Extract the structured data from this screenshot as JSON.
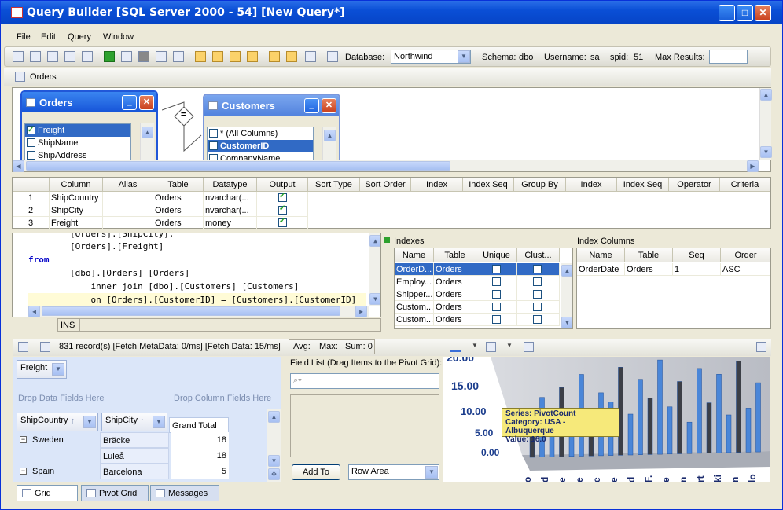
{
  "window": {
    "title": "Query Builder [SQL Server 2000 - 54] [New Query*]"
  },
  "menu": [
    "File",
    "Edit",
    "Query",
    "Window"
  ],
  "toolbar": {
    "database_label": "Database:",
    "database_value": "Northwind",
    "schema_label": "Schema:",
    "schema_value": "dbo",
    "username_label": "Username:",
    "username_value": "sa",
    "spid_label": "spid:",
    "spid_value": "51",
    "maxresults_label": "Max Results:",
    "maxresults_value": ""
  },
  "doc_tab": "Orders",
  "diagram": {
    "orders": {
      "title": "Orders",
      "fields": [
        {
          "name": "Freight",
          "checked": true,
          "selected": true
        },
        {
          "name": "ShipName",
          "checked": false,
          "selected": false
        },
        {
          "name": "ShipAddress",
          "checked": false,
          "selected": false
        }
      ]
    },
    "join_symbol": "=",
    "customers": {
      "title": "Customers",
      "fields": [
        {
          "name": "* (All Columns)",
          "checked": false,
          "selected": false
        },
        {
          "name": "CustomerID",
          "checked": false,
          "selected": true
        },
        {
          "name": "CompanyName",
          "checked": false,
          "selected": false
        }
      ]
    }
  },
  "grid": {
    "headers": [
      "Column",
      "Alias",
      "Table",
      "Datatype",
      "Output",
      "Sort Type",
      "Sort Order",
      "Index",
      "Index Seq",
      "Group By",
      "Index",
      "Index Seq",
      "Operator",
      "Criteria"
    ],
    "rows": [
      {
        "n": "1",
        "column": "ShipCountry",
        "alias": "",
        "table": "Orders",
        "datatype": "nvarchar(...",
        "output": true
      },
      {
        "n": "2",
        "column": "ShipCity",
        "alias": "",
        "table": "Orders",
        "datatype": "nvarchar(...",
        "output": true
      },
      {
        "n": "3",
        "column": "Freight",
        "alias": "",
        "table": "Orders",
        "datatype": "money",
        "output": true
      }
    ]
  },
  "sql": {
    "lines": [
      "        [Orders].[ShipCity],",
      "        [Orders].[Freight]",
      "from",
      "        [dbo].[Orders] [Orders]",
      "            inner join [dbo].[Customers] [Customers]",
      "            on [Orders].[CustomerID] = [Customers].[CustomerID]"
    ],
    "status": "INS"
  },
  "indexes": {
    "title": "Indexes",
    "headers": [
      "Name",
      "Table",
      "Unique",
      "Clust..."
    ],
    "rows": [
      {
        "name": "OrderD...",
        "table": "Orders",
        "selected": true
      },
      {
        "name": "Employ...",
        "table": "Orders",
        "selected": false
      },
      {
        "name": "Shipper...",
        "table": "Orders",
        "selected": false
      },
      {
        "name": "Custom...",
        "table": "Orders",
        "selected": false
      },
      {
        "name": "Custom...",
        "table": "Orders",
        "selected": false
      }
    ]
  },
  "index_columns": {
    "title": "Index Columns",
    "headers": [
      "Name",
      "Table",
      "Seq",
      "Order"
    ],
    "rows": [
      {
        "name": "OrderDate",
        "table": "Orders",
        "seq": "1",
        "order": "ASC"
      }
    ]
  },
  "results": {
    "status": "831 record(s) [Fetch MetaData: 0/ms] [Fetch Data: 15/ms]",
    "avg": "Avg:",
    "max": "Max:",
    "sum": "Sum: 0"
  },
  "pivot": {
    "data_field": "Freight",
    "drop_data": "Drop Data Fields Here",
    "drop_column": "Drop Column Fields Here",
    "row_fields": [
      "ShipCountry",
      "ShipCity"
    ],
    "grand_total": "Grand Total",
    "rows": [
      {
        "country": "Sweden",
        "city": "Bräcke",
        "value": "18"
      },
      {
        "country": "",
        "city": "Luleå",
        "value": "18"
      },
      {
        "country": "Spain",
        "city": "Barcelona",
        "value": "5"
      }
    ],
    "field_list_label": "Field List (Drag Items to the Pivot Grid):",
    "add_to": "Add To",
    "area": "Row Area"
  },
  "chart": {
    "y_ticks": [
      "15.00",
      "10.00",
      "5.00",
      "0.00"
    ],
    "top_tick": "20.00",
    "tooltip": {
      "series": "Series: PivotCount",
      "category": "Category: USA - Albuquerque",
      "value": "Value: 16.0"
    },
    "x_labels": [
      "o",
      "d",
      "e",
      "e",
      "e",
      "e",
      "d",
      "F.",
      "e",
      "n",
      "rt",
      "ki",
      "n",
      "lo"
    ]
  },
  "bottom_tabs": [
    "Grid",
    "Pivot Grid",
    "Messages"
  ],
  "colors": {
    "accent": "#316ac5",
    "title": "#0a4fd6"
  }
}
